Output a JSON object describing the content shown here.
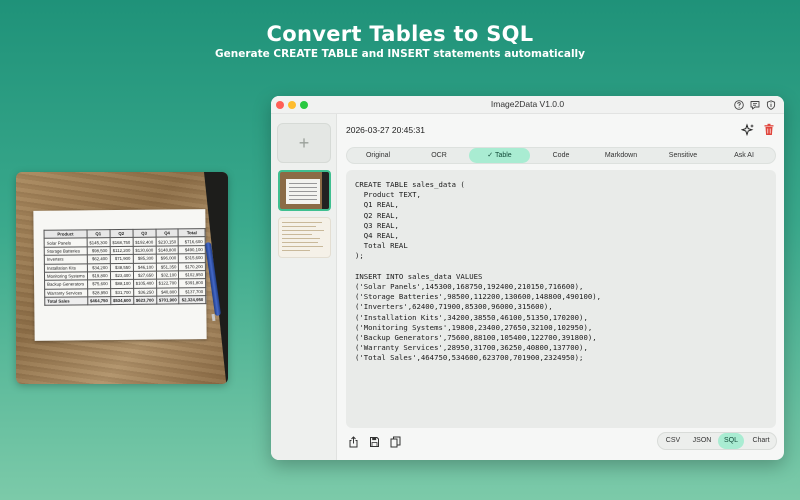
{
  "hero": {
    "title": "Convert Tables to SQL",
    "subtitle": "Generate CREATE TABLE and INSERT statements automatically"
  },
  "photo_table": {
    "headers": [
      "Product",
      "Q1",
      "Q2",
      "Q3",
      "Q4",
      "Total"
    ],
    "rows": [
      [
        "Solar Panels",
        "$145,300",
        "$168,750",
        "$192,400",
        "$210,150",
        "$716,600"
      ],
      [
        "Storage Batteries",
        "$98,500",
        "$112,200",
        "$130,600",
        "$148,800",
        "$490,100"
      ],
      [
        "Inverters",
        "$62,400",
        "$71,900",
        "$85,300",
        "$96,000",
        "$315,600"
      ],
      [
        "Installation Kits",
        "$34,200",
        "$38,550",
        "$46,100",
        "$51,350",
        "$170,200"
      ],
      [
        "Monitoring Systems",
        "$19,800",
        "$23,400",
        "$27,650",
        "$32,100",
        "$102,950"
      ],
      [
        "Backup Generators",
        "$75,600",
        "$88,100",
        "$105,400",
        "$122,700",
        "$391,800"
      ],
      [
        "Warranty Services",
        "$28,950",
        "$31,700",
        "$36,250",
        "$40,800",
        "$137,700"
      ]
    ],
    "total": [
      "Total Sales",
      "$464,750",
      "$534,600",
      "$623,700",
      "$701,900",
      "$2,324,950"
    ]
  },
  "window": {
    "title": "Image2Data V1.0.0",
    "icons": [
      "help-icon",
      "chat-icon",
      "info-icon"
    ]
  },
  "sidebar": {
    "add_label": "+"
  },
  "main": {
    "timestamp": "2026-03-27 20:45:31",
    "tabs": [
      {
        "label": "Original"
      },
      {
        "label": "OCR"
      },
      {
        "label": "✓ Table"
      },
      {
        "label": "Code"
      },
      {
        "label": "Markdown"
      },
      {
        "label": "Sensitive"
      },
      {
        "label": "Ask AI"
      }
    ],
    "active_tab": "Table",
    "code_lines": [
      "CREATE TABLE sales_data (",
      "  Product TEXT,",
      "  Q1 REAL,",
      "  Q2 REAL,",
      "  Q3 REAL,",
      "  Q4 REAL,",
      "  Total REAL",
      ");",
      "",
      "INSERT INTO sales_data VALUES",
      "('Solar Panels',145300,168750,192400,210150,716600),",
      "('Storage Batteries',98500,112200,130600,148800,490100),",
      "('Inverters',62400,71900,85300,96000,315600),",
      "('Installation Kits',34200,38550,46100,51350,170200),",
      "('Monitoring Systems',19800,23400,27650,32100,102950),",
      "('Backup Generators',75600,88100,105400,122700,391800),",
      "('Warranty Services',28950,31700,36250,40800,137700),",
      "('Total Sales',464750,534600,623700,701900,2324950);"
    ],
    "formats": [
      {
        "label": "CSV"
      },
      {
        "label": "JSON"
      },
      {
        "label": "SQL"
      },
      {
        "label": "Chart"
      }
    ],
    "active_format": "SQL"
  },
  "colors": {
    "accent": "#a9ecd2",
    "background_top": "#1f9279",
    "close": "#ff5f57",
    "minimize": "#febc2e",
    "maximize": "#28c840",
    "delete": "#e0443b"
  }
}
